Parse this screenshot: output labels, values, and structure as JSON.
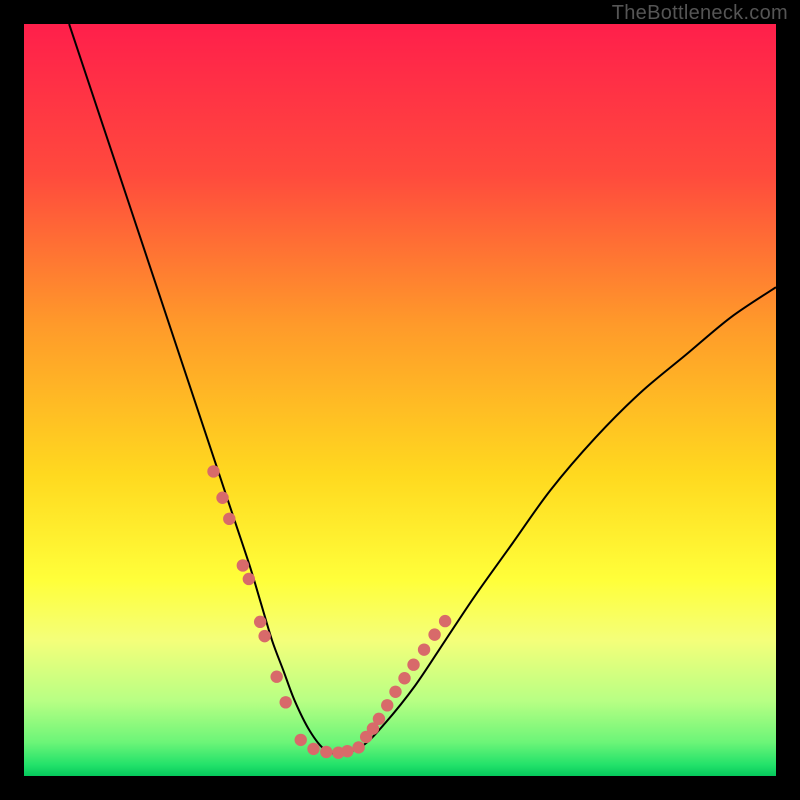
{
  "watermark": "TheBottleneck.com",
  "chart_data": {
    "type": "line",
    "title": "",
    "xlabel": "",
    "ylabel": "",
    "xlim": [
      0,
      100
    ],
    "ylim": [
      0,
      100
    ],
    "gradient_stops": [
      {
        "offset": 0.0,
        "color": "#ff1f4b"
      },
      {
        "offset": 0.2,
        "color": "#ff4a3d"
      },
      {
        "offset": 0.4,
        "color": "#ff9a2a"
      },
      {
        "offset": 0.6,
        "color": "#ffd91f"
      },
      {
        "offset": 0.74,
        "color": "#ffff3a"
      },
      {
        "offset": 0.82,
        "color": "#f4ff7a"
      },
      {
        "offset": 0.9,
        "color": "#b8ff84"
      },
      {
        "offset": 0.955,
        "color": "#6cf578"
      },
      {
        "offset": 0.985,
        "color": "#23e26a"
      },
      {
        "offset": 1.0,
        "color": "#05c85c"
      }
    ],
    "series": [
      {
        "name": "bottleneck-curve",
        "type": "line",
        "x": [
          6,
          9,
          12,
          15,
          18,
          21,
          24,
          26,
          28,
          30,
          31.5,
          33,
          34.5,
          36,
          38,
          40,
          42,
          45,
          48,
          52,
          56,
          60,
          65,
          70,
          76,
          82,
          88,
          94,
          100
        ],
        "y": [
          100,
          91,
          82,
          73,
          64,
          55,
          46,
          40,
          34,
          28,
          23,
          18,
          14,
          10,
          6,
          3.5,
          3,
          4,
          7,
          12,
          18,
          24,
          31,
          38,
          45,
          51,
          56,
          61,
          65
        ]
      },
      {
        "name": "left-branch-markers",
        "type": "scatter",
        "color": "#d86a6a",
        "x": [
          25.2,
          26.4,
          27.3,
          29.1,
          29.9,
          31.4,
          32.0,
          33.6,
          34.8
        ],
        "y": [
          40.5,
          37.0,
          34.2,
          28.0,
          26.2,
          20.5,
          18.6,
          13.2,
          9.8
        ]
      },
      {
        "name": "trough-markers",
        "type": "scatter",
        "color": "#d86a6a",
        "x": [
          36.8,
          38.5,
          40.2,
          41.8,
          43.0,
          44.5
        ],
        "y": [
          4.8,
          3.6,
          3.2,
          3.1,
          3.3,
          3.8
        ]
      },
      {
        "name": "right-branch-markers",
        "type": "scatter",
        "color": "#d86a6a",
        "x": [
          45.5,
          46.4,
          47.2,
          48.3,
          49.4,
          50.6,
          51.8,
          53.2,
          54.6,
          56.0
        ],
        "y": [
          5.2,
          6.3,
          7.6,
          9.4,
          11.2,
          13.0,
          14.8,
          16.8,
          18.8,
          20.6
        ]
      }
    ]
  }
}
